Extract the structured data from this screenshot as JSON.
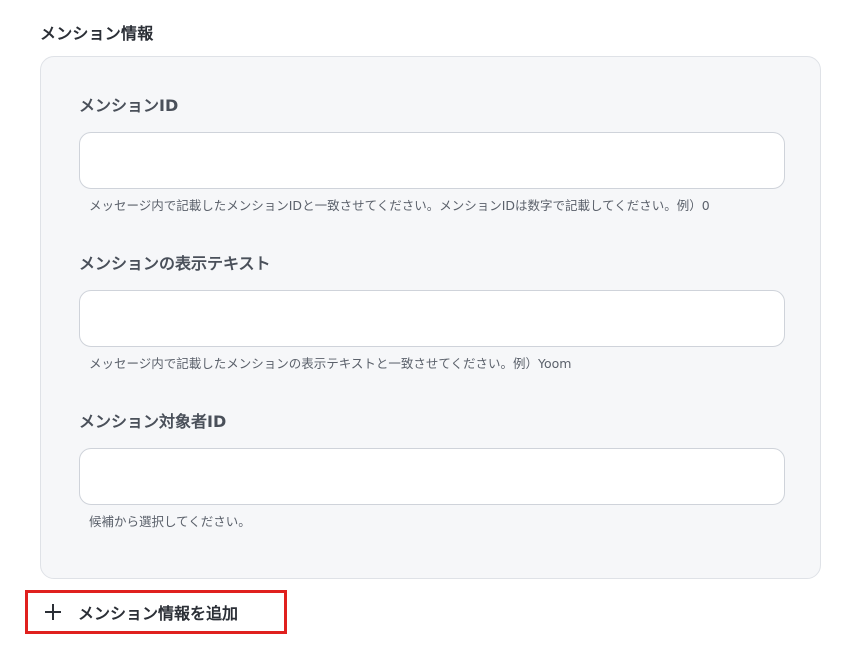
{
  "section": {
    "title": "メンション情報"
  },
  "fields": [
    {
      "label": "メンションID",
      "value": "",
      "hint": "メッセージ内で記載したメンションIDと一致させてください。メンションIDは数字で記載してください。例）0"
    },
    {
      "label": "メンションの表示テキスト",
      "value": "",
      "hint": "メッセージ内で記載したメンションの表示テキストと一致させてください。例）Yoom"
    },
    {
      "label": "メンション対象者ID",
      "value": "",
      "hint": "候補から選択してください。"
    }
  ],
  "add_button": {
    "label": "メンション情報を追加",
    "icon": "plus-icon",
    "highlight_color": "#e0201e"
  }
}
